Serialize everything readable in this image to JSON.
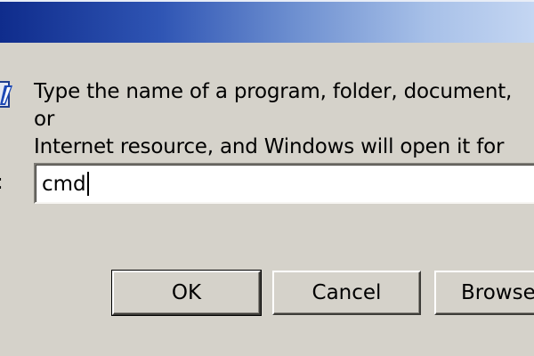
{
  "dialog": {
    "message_line1": "Type the name of a program, folder, document, or",
    "message_line2": "Internet resource, and Windows will open it for you.",
    "field_label_fragment": ":",
    "command_value": "cmd",
    "icon": "run-icon"
  },
  "buttons": {
    "ok": "OK",
    "cancel": "Cancel",
    "browse": "Browse"
  },
  "colors": {
    "dialog_background": "#d5d2ca",
    "title_bar_start": "#0f2c8c",
    "title_bar_end": "#c4d6f2"
  }
}
